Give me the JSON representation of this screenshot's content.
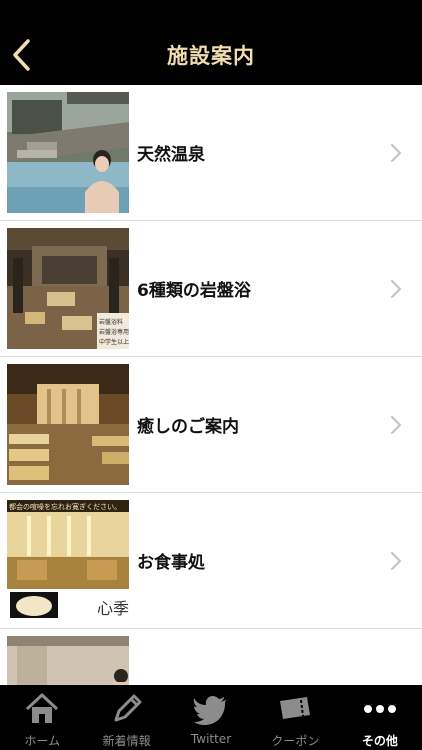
{
  "nav": {
    "title": "施設案内"
  },
  "list": {
    "items": [
      {
        "label": "天然温泉"
      },
      {
        "label": "6種類の岩盤浴",
        "sign_lines": [
          "岩盤浴料",
          "岩盤浴専用",
          "中学生以上"
        ]
      },
      {
        "label": "癒しのご案内"
      },
      {
        "label": "お食事処",
        "banner_text": "都会の喧噪を忘れお寛ぎください。",
        "calligraphy": "心季"
      },
      {
        "label": ""
      }
    ]
  },
  "tabbar": {
    "tabs": [
      {
        "label": "ホーム",
        "icon": "home-icon"
      },
      {
        "label": "新着情報",
        "icon": "pencil-icon"
      },
      {
        "label": "Twitter",
        "icon": "twitter-bird-icon"
      },
      {
        "label": "クーポン",
        "icon": "ticket-icon"
      },
      {
        "label": "その他",
        "icon": "more-dots-icon",
        "active": true
      }
    ]
  },
  "colors": {
    "navbar": "#000000",
    "title": "#f2dcb0",
    "tab_inactive": "#8c8c8c",
    "tab_active": "#ffffff",
    "divider": "#dcdcdc"
  }
}
